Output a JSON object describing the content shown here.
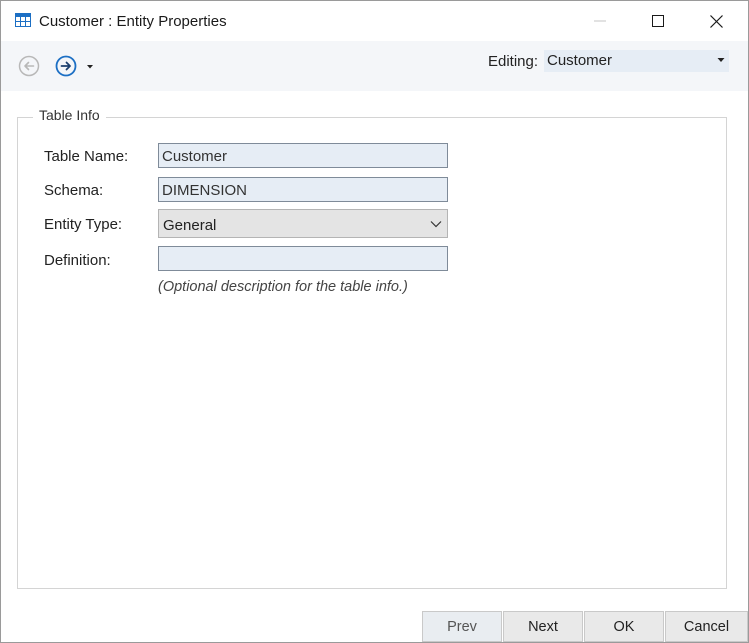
{
  "window": {
    "title": "Customer : Entity Properties"
  },
  "toolbar": {
    "editing_label": "Editing:",
    "editing_value": "Customer"
  },
  "table_info": {
    "legend": "Table Info",
    "table_name_label": "Table Name:",
    "table_name_value": "Customer",
    "schema_label": "Schema:",
    "schema_value": "DIMENSION",
    "entity_type_label": "Entity Type:",
    "entity_type_value": "General",
    "definition_label": "Definition:",
    "definition_value": "",
    "definition_hint": "(Optional description for the table info.)"
  },
  "footer": {
    "prev_label": "Prev",
    "next_label": "Next",
    "ok_label": "OK",
    "cancel_label": "Cancel"
  },
  "colors": {
    "accent": "#1c6fc4",
    "field_bg": "#e6edf5",
    "toolbar_bg": "#f4f6f9"
  }
}
